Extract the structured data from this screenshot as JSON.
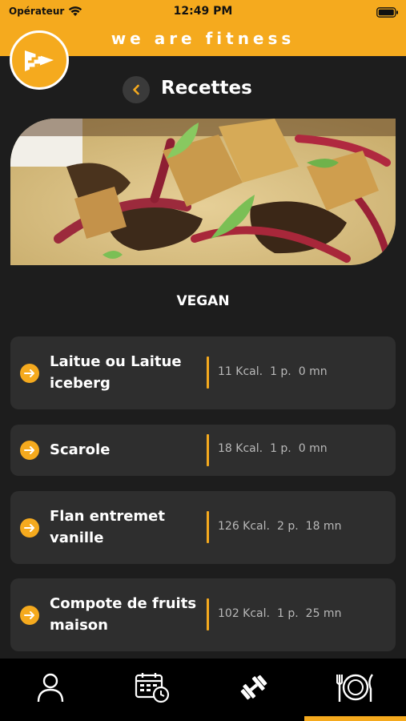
{
  "status_bar": {
    "carrier": "Opérateur",
    "time": "12:49 PM"
  },
  "header": {
    "brand": "we are fitness"
  },
  "page": {
    "title": "Recettes",
    "category": "VEGAN"
  },
  "recipes": [
    {
      "name": "Laitue ou Laitue iceberg",
      "kcal": "11 Kcal.",
      "portions": "1 p.",
      "time": "0 mn"
    },
    {
      "name": "Scarole",
      "kcal": "18 Kcal.",
      "portions": "1 p.",
      "time": "0 mn"
    },
    {
      "name": "Flan entremet vanille",
      "kcal": "126 Kcal.",
      "portions": "2 p.",
      "time": "18 mn"
    },
    {
      "name": "Compote de fruits maison",
      "kcal": "102 Kcal.",
      "portions": "1 p.",
      "time": "25 mn"
    }
  ],
  "tabs": [
    {
      "icon": "user-profile-icon",
      "active": false
    },
    {
      "icon": "calendar-clock-icon",
      "active": false
    },
    {
      "icon": "dumbbell-icon",
      "active": false
    },
    {
      "icon": "plate-cutlery-icon",
      "active": true
    }
  ],
  "colors": {
    "accent": "#f5aa1e",
    "background": "#1d1d1d",
    "card": "#2e2e2e",
    "tab_bar": "#000000"
  }
}
